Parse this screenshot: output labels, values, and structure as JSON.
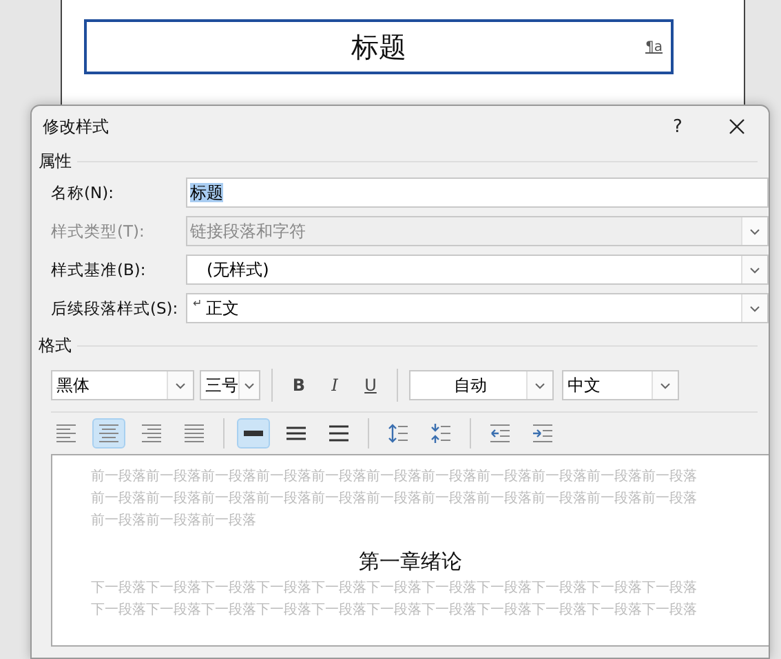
{
  "document": {
    "style_boxes": [
      {
        "text": "标题",
        "mark": "¶a",
        "selected": true
      }
    ]
  },
  "dialog": {
    "title": "修改样式",
    "help": "?",
    "properties": {
      "label": "属性",
      "fields": [
        {
          "label": "名称(N):",
          "kind": "text",
          "value": "标题",
          "value_selected": true,
          "disabled": false
        },
        {
          "label": "样式类型(T):",
          "kind": "select",
          "value": "链接段落和字符",
          "value_selected": false,
          "disabled": true
        },
        {
          "label": "样式基准(B):",
          "kind": "select",
          "value": "(无样式)",
          "value_selected": false,
          "disabled": false
        },
        {
          "label": "后续段落样式(S):",
          "kind": "select",
          "value": "正文",
          "return_mark": "↵",
          "value_selected": false,
          "disabled": false
        }
      ]
    },
    "format": {
      "label": "格式",
      "font": "黑体",
      "size": "三号",
      "styles": [
        {
          "text": "B",
          "kind": "bold"
        },
        {
          "text": "I",
          "kind": "italic"
        },
        {
          "text": "U",
          "kind": "underline"
        }
      ],
      "font_color_label": "自动",
      "language": "中文",
      "paragraph_buttons": [
        {
          "kind": "align-left",
          "selected": false
        },
        {
          "kind": "align-center",
          "selected": true
        },
        {
          "kind": "align-right",
          "selected": false
        },
        {
          "kind": "justify",
          "selected": false
        },
        {
          "kind": "spacing-single",
          "selected": true
        },
        {
          "kind": "spacing-one-half",
          "selected": false
        },
        {
          "kind": "spacing-double",
          "selected": false
        },
        {
          "kind": "space-before-increase",
          "selected": false
        },
        {
          "kind": "space-before-decrease",
          "selected": false
        },
        {
          "kind": "indent-decrease",
          "selected": false
        },
        {
          "kind": "indent-increase",
          "selected": false
        }
      ]
    },
    "preview": {
      "before_lines": [
        "前一段落前一段落前一段落前一段落前一段落前一段落前一段落前一段落前一段落前一段落前一段落",
        "前一段落前一段落前一段落前一段落前一段落前一段落前一段落前一段落前一段落前一段落前一段落",
        "前一段落前一段落前一段落"
      ],
      "heading": "第一章绪论",
      "after_lines": [
        "下一段落下一段落下一段落下一段落下一段落下一段落下一段落下一段落下一段落下一段落下一段落",
        "下一段落下一段落下一段落下一段落下一段落下一段落下一段落下一段落下一段落下一段落下一段落"
      ]
    }
  }
}
